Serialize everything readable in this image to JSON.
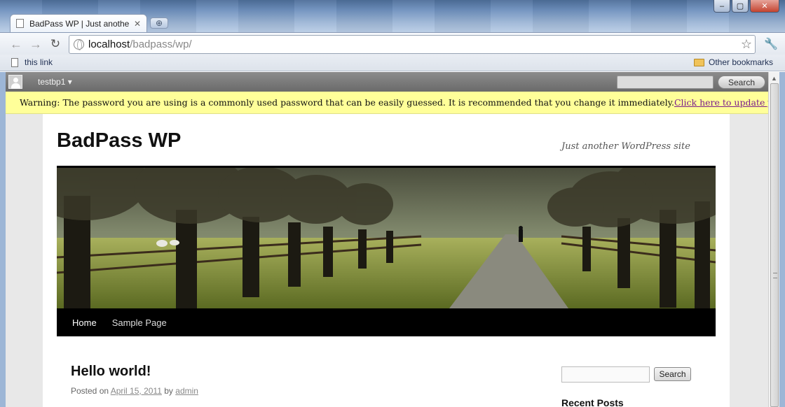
{
  "browser": {
    "tab_title": "BadPass WP | Just anothe...",
    "url_host": "localhost",
    "url_path": "/badpass/wp/",
    "bookmarks": {
      "left_item": "this link",
      "right_item": "Other bookmarks"
    }
  },
  "adminbar": {
    "username": "testbp1",
    "search_button": "Search"
  },
  "warning": {
    "text": "Warning: The password you are using is a commonly used password that can be easily guessed. It is recommended that you change it immediately.",
    "link": "Click here to update your password."
  },
  "site": {
    "title": "BadPass WP",
    "description": "Just another WordPress site",
    "nav": [
      "Home",
      "Sample Page"
    ],
    "post": {
      "title": "Hello world!",
      "posted_on": "Posted on",
      "date": "April 15, 2011",
      "by": "by",
      "author": "admin"
    },
    "sidebar": {
      "search_button": "Search",
      "recent_heading": "Recent Posts"
    }
  }
}
